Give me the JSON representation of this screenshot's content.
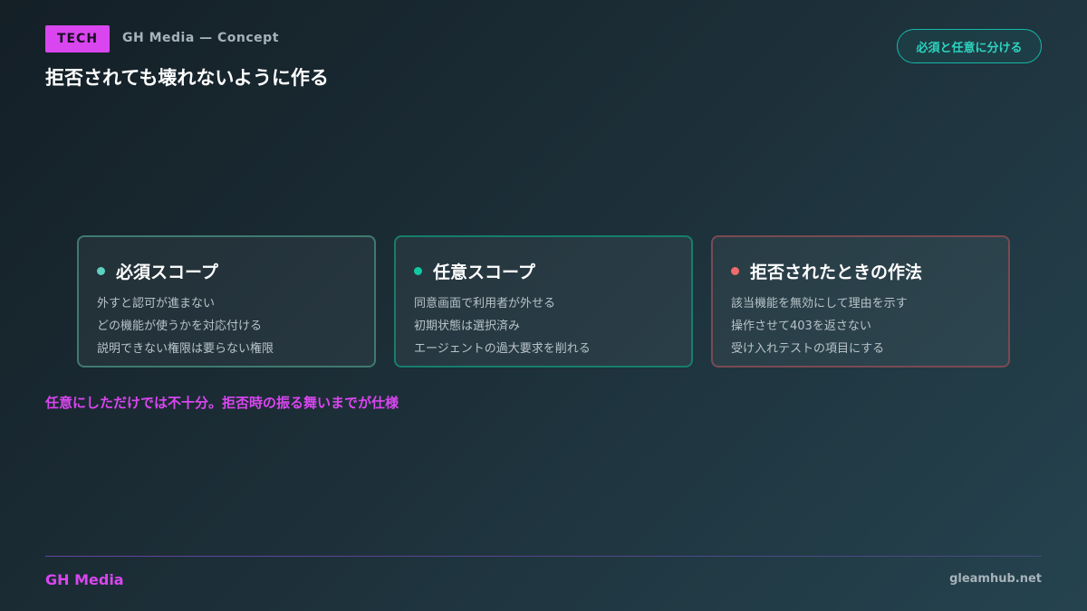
{
  "header": {
    "tag": "TECH",
    "brand_concept": "GH Media — Concept",
    "title": "拒否されても壊れないように作る",
    "pill": "必須と任意に分ける"
  },
  "cards": [
    {
      "title": "必須スコープ",
      "dot_color": "#5ed0c0",
      "lines": [
        "外すと認可が進まない",
        "どの機能が使うかを対応付ける",
        "説明できない権限は要らない権限"
      ]
    },
    {
      "title": "任意スコープ",
      "dot_color": "#10c9a0",
      "lines": [
        "同意画面で利用者が外せる",
        "初期状態は選択済み",
        "エージェントの過大要求を削れる"
      ]
    },
    {
      "title": "拒否されたときの作法",
      "dot_color": "#f06b6b",
      "lines": [
        "該当機能を無効にして理由を示す",
        "操作させて403を返さない",
        "受け入れテストの項目にする"
      ]
    }
  ],
  "note": "任意にしただけでは不十分。拒否時の振る舞いまでが仕様",
  "footer": {
    "brand": "GH Media",
    "url": "gleamhub.net"
  },
  "colors": {
    "accent": "#d946ef",
    "teal": "#14b8a6"
  }
}
